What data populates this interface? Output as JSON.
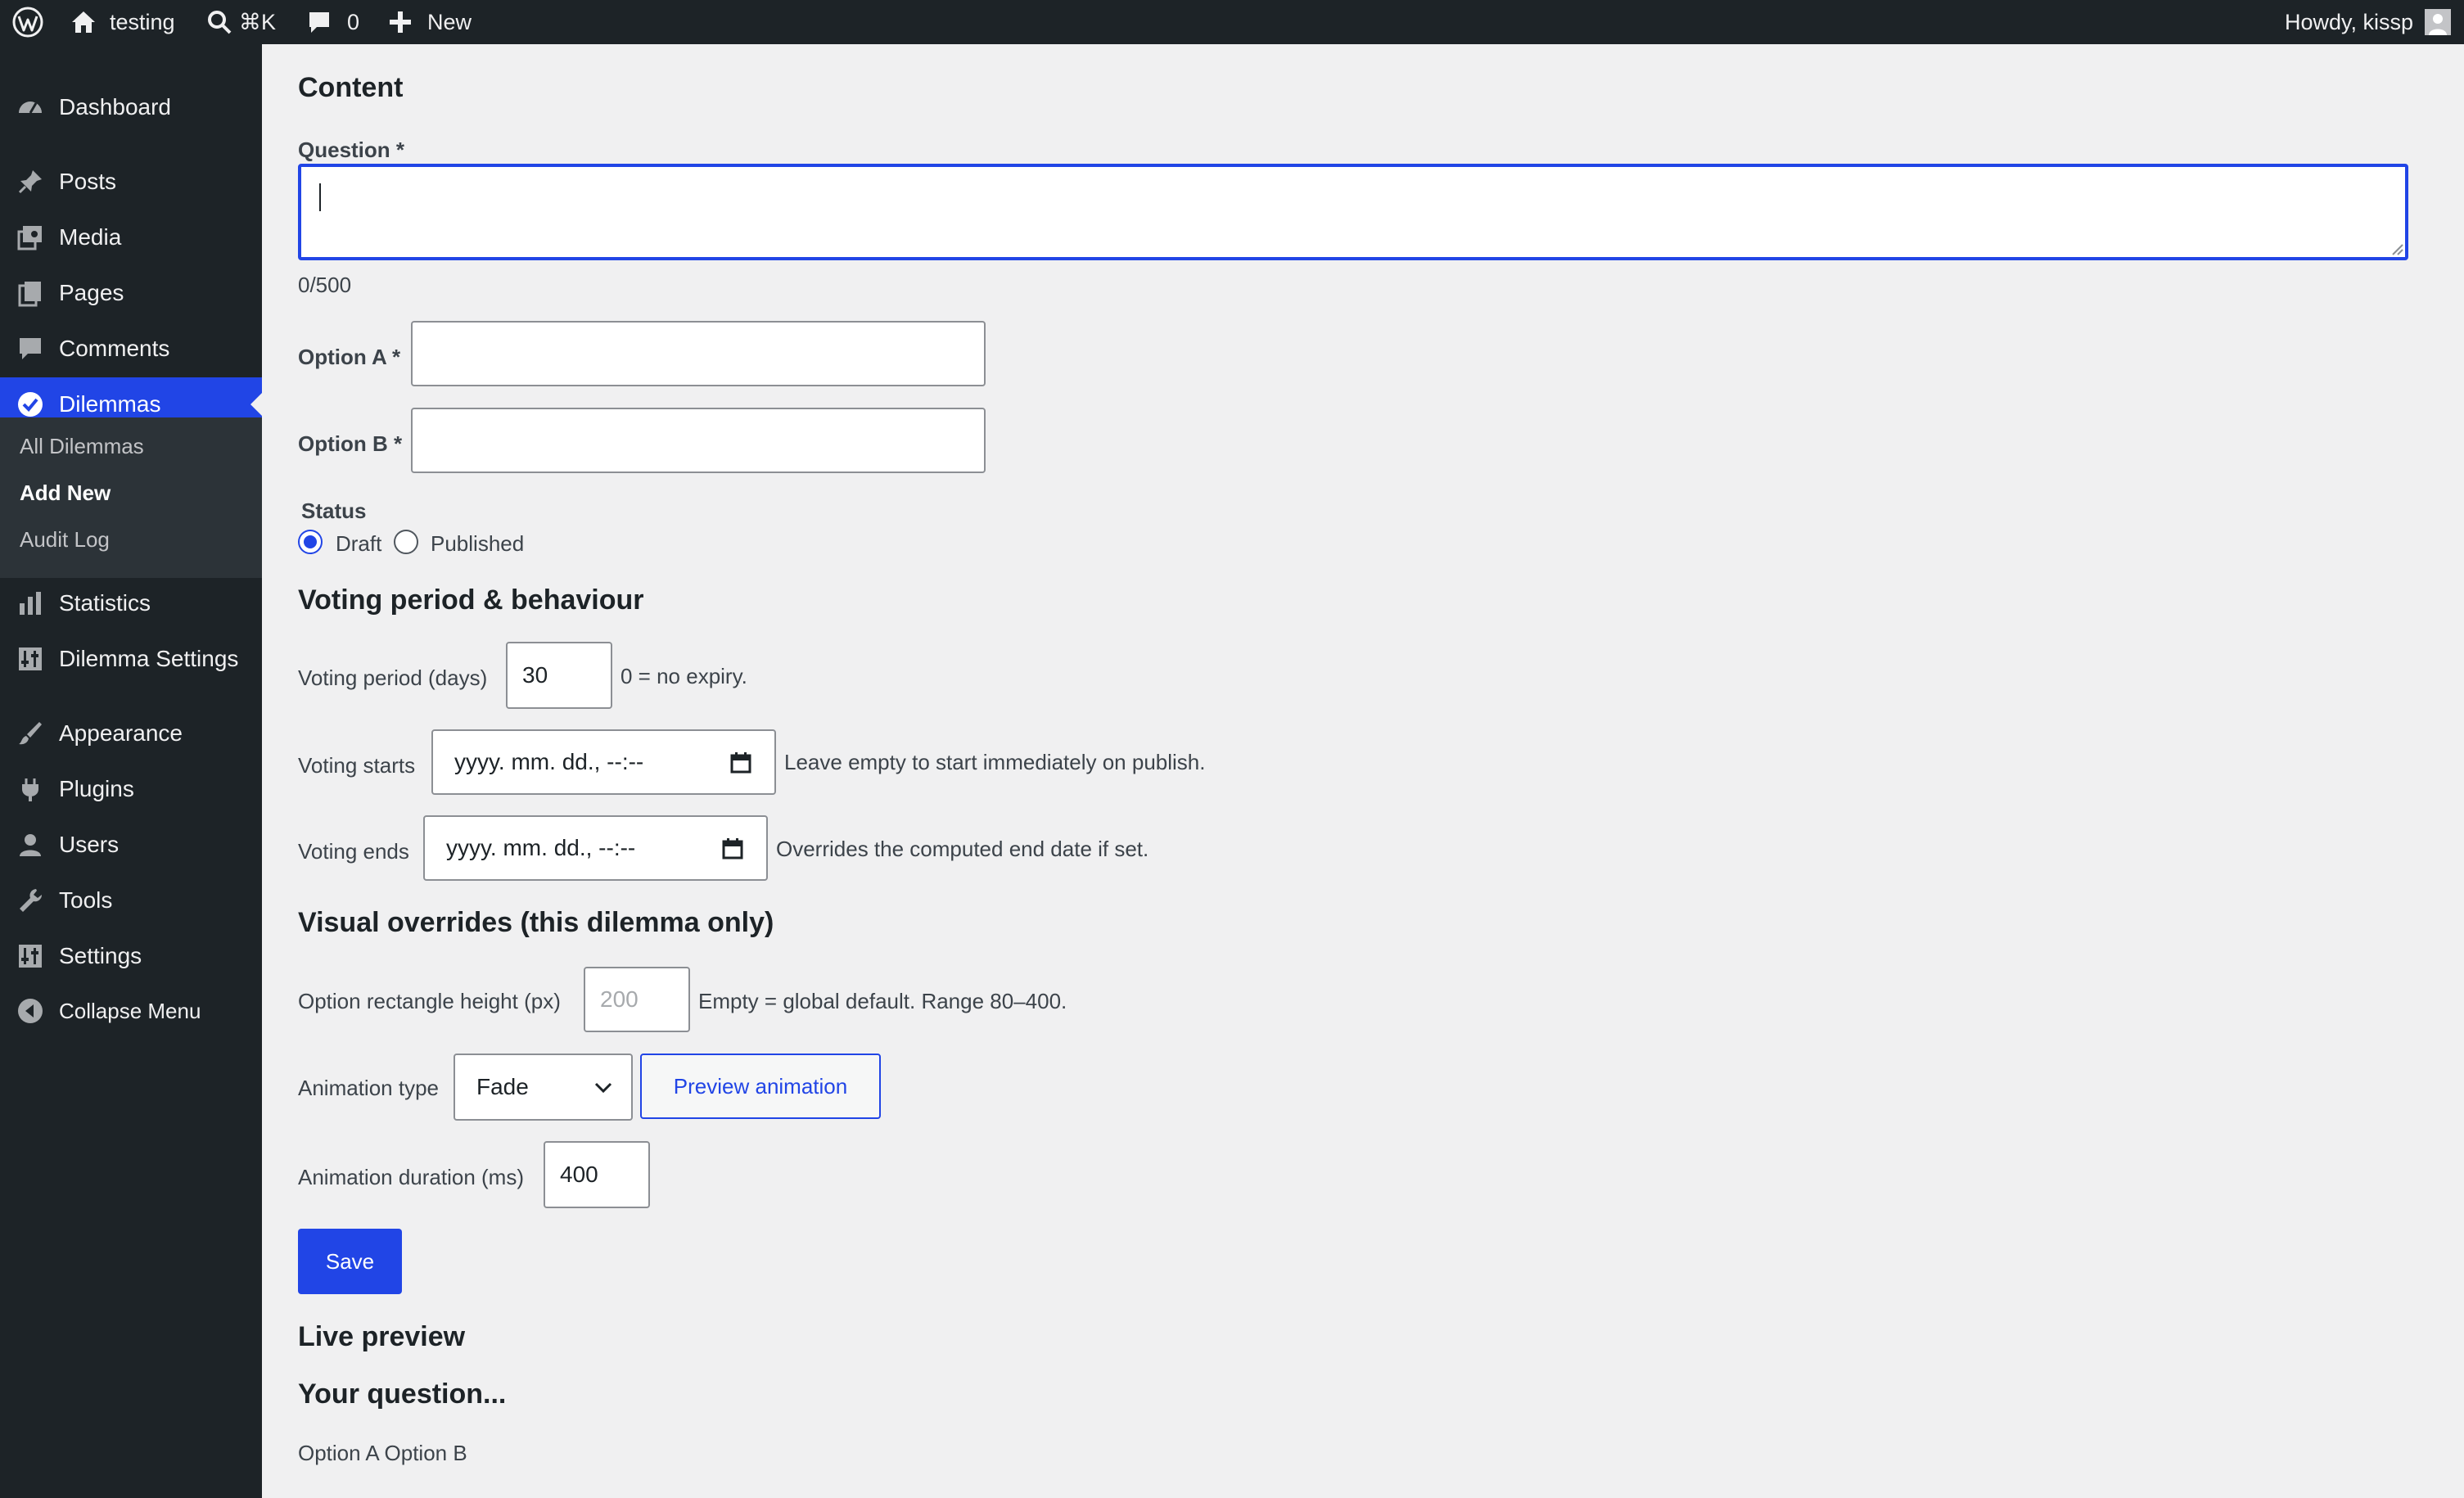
{
  "adminbar": {
    "site_name": "testing",
    "search_shortcut": "⌘K",
    "comments_count": "0",
    "new_label": "New",
    "greeting": "Howdy, kissp"
  },
  "sidebar": {
    "items": [
      {
        "label": "Dashboard",
        "icon": "dashboard-icon"
      },
      {
        "label": "Posts",
        "icon": "pin-icon"
      },
      {
        "label": "Media",
        "icon": "media-icon"
      },
      {
        "label": "Pages",
        "icon": "pages-icon"
      },
      {
        "label": "Comments",
        "icon": "comment-icon"
      },
      {
        "label": "Dilemmas",
        "icon": "check-circle-icon"
      },
      {
        "label": "Statistics",
        "icon": "bar-chart-icon"
      },
      {
        "label": "Dilemma Settings",
        "icon": "settings-sliders-icon"
      },
      {
        "label": "Appearance",
        "icon": "paintbrush-icon"
      },
      {
        "label": "Plugins",
        "icon": "plugin-icon"
      },
      {
        "label": "Users",
        "icon": "user-icon"
      },
      {
        "label": "Tools",
        "icon": "wrench-icon"
      },
      {
        "label": "Settings",
        "icon": "settings-sliders-icon"
      },
      {
        "label": "Collapse Menu",
        "icon": "collapse-icon"
      }
    ],
    "submenu": [
      "All Dilemmas",
      "Add New",
      "Audit Log"
    ],
    "active_color": "#2145e6"
  },
  "form": {
    "content_heading": "Content",
    "question_label": "Question *",
    "question_value": "",
    "char_counter": "0/500",
    "option_a_label": "Option A *",
    "option_a_value": "",
    "option_b_label": "Option B *",
    "option_b_value": "",
    "status_label": "Status",
    "status_options": [
      "Draft",
      "Published"
    ],
    "status_selected": "Draft",
    "voting_heading": "Voting period & behaviour",
    "voting_period_label": "Voting period (days)",
    "voting_period_value": "30",
    "voting_period_hint": "0 = no expiry.",
    "voting_starts_label": "Voting starts",
    "voting_starts_value": "yyyy. mm. dd., --:--",
    "voting_starts_hint": "Leave empty to start immediately on publish.",
    "voting_ends_label": "Voting ends",
    "voting_ends_value": "yyyy. mm. dd., --:--",
    "voting_ends_hint": "Overrides the computed end date if set.",
    "visual_heading": "Visual overrides (this dilemma only)",
    "rect_height_label": "Option rectangle height (px)",
    "rect_height_placeholder": "200",
    "rect_height_hint": "Empty = global default. Range 80–400.",
    "animation_type_label": "Animation type",
    "animation_type_value": "Fade",
    "preview_button": "Preview animation",
    "animation_duration_label": "Animation duration (ms)",
    "animation_duration_value": "400",
    "save_button": "Save"
  },
  "preview": {
    "heading": "Live preview",
    "question": "Your question...",
    "options": "Option A Option B"
  }
}
